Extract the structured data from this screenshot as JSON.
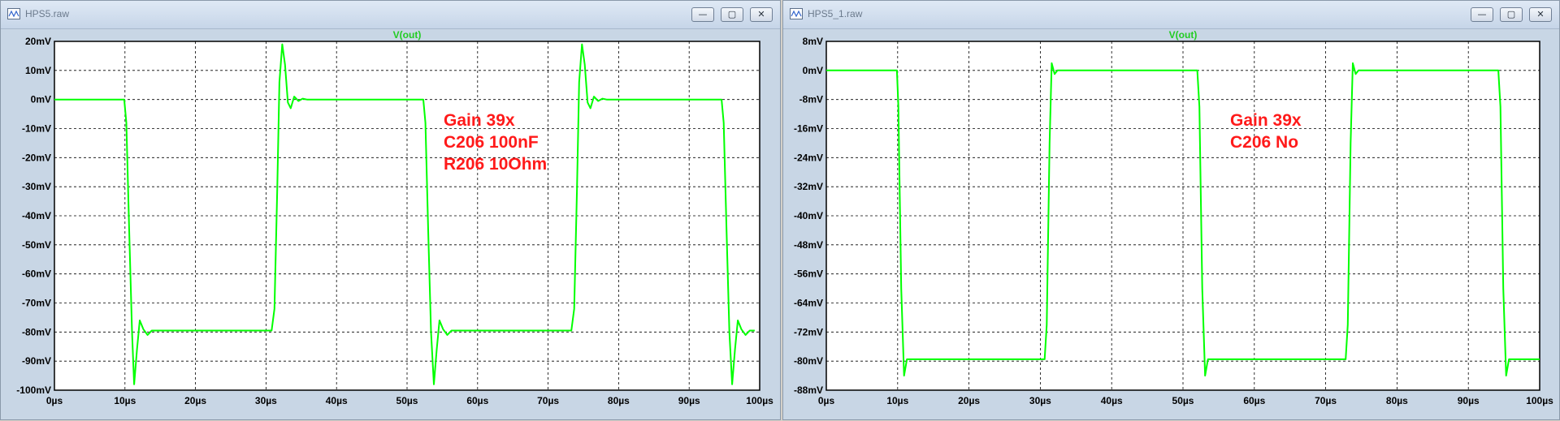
{
  "windows": [
    {
      "id": "left",
      "title": "HPS5.raw",
      "buttons": {
        "minimize": "—",
        "maximize": "▢",
        "close": "✕"
      },
      "plot": {
        "trace_label": "V(out)",
        "trace_color": "#00ff00",
        "annotation_color": "#ff1a1a",
        "annotation_lines": [
          "Gain 39x",
          "C206 100nF",
          "R206 10Ohm"
        ],
        "y_ticks": [
          "20mV",
          "10mV",
          "0mV",
          "-10mV",
          "-20mV",
          "-30mV",
          "-40mV",
          "-50mV",
          "-60mV",
          "-70mV",
          "-80mV",
          "-90mV",
          "-100mV"
        ],
        "x_ticks": [
          "0µs",
          "10µs",
          "20µs",
          "30µs",
          "40µs",
          "50µs",
          "60µs",
          "70µs",
          "80µs",
          "90µs",
          "100µs"
        ]
      },
      "chart_data": {
        "type": "line",
        "xlabel": "",
        "ylabel": "",
        "xlim": [
          0,
          100
        ],
        "ylim": [
          -100,
          20
        ],
        "grid": true,
        "series": [
          {
            "name": "V(out)",
            "x": [
              0,
              9.9,
              10.2,
              10.6,
              11.0,
              11.3,
              11.7,
              12.1,
              12.6,
              13.2,
              13.8,
              14.5,
              30.8,
              31.2,
              31.6,
              31.9,
              32.3,
              32.7,
              33.1,
              33.5,
              34.0,
              34.6,
              35.2,
              35.8,
              52.3,
              52.6,
              53.0,
              53.4,
              53.8,
              54.2,
              54.6,
              55.1,
              55.7,
              56.3,
              57.0,
              73.3,
              73.7,
              74.1,
              74.4,
              74.8,
              75.2,
              75.6,
              76.0,
              76.5,
              77.1,
              77.7,
              78.3,
              94.6,
              94.9,
              95.3,
              95.7,
              96.1,
              96.5,
              96.9,
              97.4,
              98.0,
              98.6,
              99.3,
              100
            ],
            "y": [
              0,
              0,
              -8,
              -45,
              -80,
              -98,
              -86,
              -76,
              -79,
              -81,
              -79.5,
              -79.5,
              -79.5,
              -72,
              -30,
              6,
              19,
              12,
              -1,
              -3,
              1,
              -0.5,
              0.3,
              0,
              0,
              -8,
              -45,
              -80,
              -98,
              -86,
              -76,
              -79,
              -81,
              -79.5,
              -79.5,
              -79.5,
              -72,
              -30,
              6,
              19,
              12,
              -1,
              -3,
              1,
              -0.5,
              0.3,
              0,
              0,
              -8,
              -45,
              -80,
              -98,
              -86,
              -76,
              -79,
              -81,
              -79.5,
              -79.5
            ]
          }
        ]
      }
    },
    {
      "id": "right",
      "title": "HPS5_1.raw",
      "buttons": {
        "minimize": "—",
        "maximize": "▢",
        "close": "✕"
      },
      "plot": {
        "trace_label": "V(out)",
        "trace_color": "#00ff00",
        "annotation_color": "#ff1a1a",
        "annotation_lines": [
          "Gain 39x",
          "C206 No"
        ],
        "y_ticks": [
          "8mV",
          "0mV",
          "-8mV",
          "-16mV",
          "-24mV",
          "-32mV",
          "-40mV",
          "-48mV",
          "-56mV",
          "-64mV",
          "-72mV",
          "-80mV",
          "-88mV"
        ],
        "x_ticks": [
          "0µs",
          "10µs",
          "20µs",
          "30µs",
          "40µs",
          "50µs",
          "60µs",
          "70µs",
          "80µs",
          "90µs",
          "100µs"
        ]
      },
      "chart_data": {
        "type": "line",
        "xlabel": "",
        "ylabel": "",
        "xlim": [
          0,
          100
        ],
        "ylim": [
          -88,
          8
        ],
        "grid": true,
        "series": [
          {
            "name": "V(out)",
            "x": [
              0,
              9.9,
              10.1,
              10.5,
              10.9,
              11.3,
              12.0,
              30.6,
              30.9,
              31.3,
              31.6,
              32.0,
              32.4,
              33.0,
              52.0,
              52.3,
              52.7,
              53.1,
              53.5,
              54.2,
              72.8,
              73.1,
              73.5,
              73.8,
              74.2,
              74.6,
              75.2,
              94.2,
              94.5,
              94.9,
              95.3,
              95.7,
              96.4,
              100
            ],
            "y": [
              0,
              0,
              -10,
              -60,
              -84,
              -79.5,
              -79.5,
              -79.5,
              -70,
              -20,
              2,
              -1,
              0,
              0,
              0,
              -10,
              -60,
              -84,
              -79.5,
              -79.5,
              -79.5,
              -70,
              -20,
              2,
              -1,
              0,
              0,
              0,
              -10,
              -60,
              -84,
              -79.5,
              -79.5,
              -79.5
            ]
          }
        ]
      }
    }
  ]
}
